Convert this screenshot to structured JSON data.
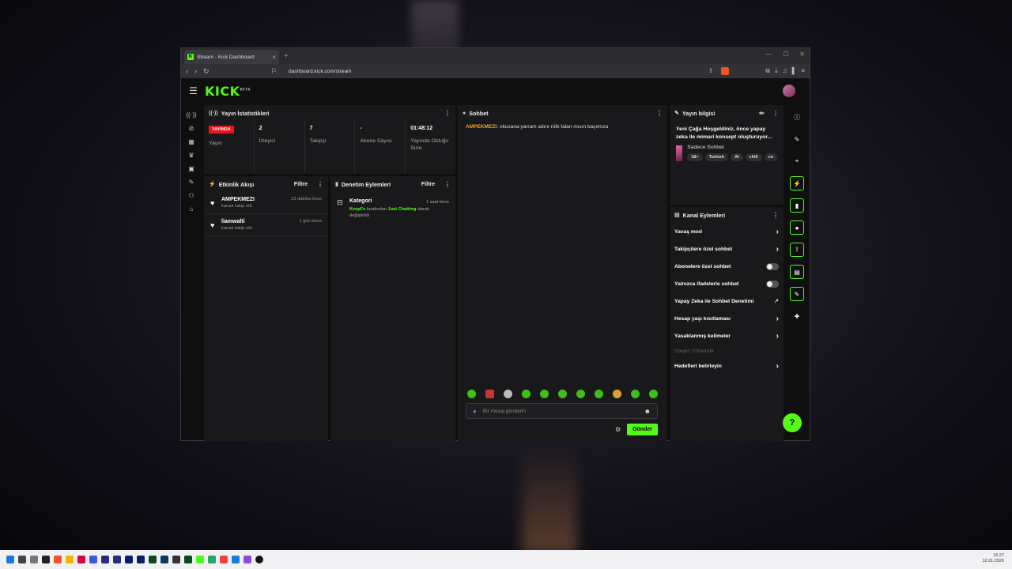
{
  "browser": {
    "tab_title": "Stream - Kick Dashboard",
    "url": "dashboard.kick.com/stream",
    "new_tab": "+",
    "min": "—",
    "max": "☐",
    "close": "✕"
  },
  "app": {
    "logo": "KICK",
    "logo_beta": "BETA"
  },
  "stats_panel": {
    "title": "Yayın İstatistikleri",
    "live_badge": "YAYINDA",
    "stats": [
      {
        "value": "",
        "label": "Yayın"
      },
      {
        "value": "2",
        "label": "İzleyici"
      },
      {
        "value": "7",
        "label": "Takipçi"
      },
      {
        "value": "-",
        "label": "Abone Sayısı"
      },
      {
        "value": "01:48:12",
        "label": "Yayında Olduğu Süre"
      }
    ]
  },
  "activity_panel": {
    "title": "Etkinlik Akışı",
    "filter": "Filtre",
    "events": [
      {
        "name": "AMPEKMEZI",
        "sub": "kanalı takip etti",
        "time": "23 dakika önce"
      },
      {
        "name": "liamwalti",
        "sub": "kanalı takip etti",
        "time": "1 gün önce"
      }
    ]
  },
  "mod_panel": {
    "title": "Denetim Eylemleri",
    "filter": "Filtre",
    "item": {
      "name": "Kategori",
      "time": "1 saat önce",
      "user": "KeepFs",
      "mid": " tarafından ",
      "category": "Just Chatting",
      "tail": " olarak değiştirildi"
    }
  },
  "chat_panel": {
    "title": "Sohbet",
    "messages": [
      {
        "user": "AMPEKMEZI:",
        "text": " okusana yarram adını rütk falan mısın başımıza"
      }
    ],
    "input_placeholder": "Bir mesaj gönderin",
    "send_label": "Gönder"
  },
  "info_panel": {
    "title": "Yayın bilgisi",
    "stream_title": "Yeni Çağa Hoşgeldiniz, önce yapay zeka ile mimari konsept oluşturuyor...",
    "category": "Sadece Sohbet",
    "tags": [
      "18+",
      "Turkish",
      "AI",
      "chill",
      "co"
    ]
  },
  "channel_actions": {
    "title": "Kanal Eylemleri",
    "items": [
      {
        "label": "Yavaş mod",
        "control": "chevron"
      },
      {
        "label": "Takipçilere özel sohbet",
        "control": "chevron"
      },
      {
        "label": "Abonelere özel sohbet",
        "control": "toggle"
      },
      {
        "label": "Yalnızca ifadelerle sohbet",
        "control": "toggle"
      },
      {
        "label": "Yapay Zeka ile Sohbet Denetimi",
        "control": "external"
      },
      {
        "label": "Hesap yaşı kısıtlaması",
        "control": "chevron"
      },
      {
        "label": "Yasaklanmış kelimeler",
        "control": "chevron"
      }
    ],
    "section_label": "İzleyici Yönlendir",
    "goal": "Hedefleri belirleyin"
  },
  "taskbar": {
    "time": "16:27",
    "date": "12.01.2026"
  },
  "colors": {
    "accent": "#53fc18",
    "live": "#e8161c",
    "username": "#f3a12e"
  }
}
